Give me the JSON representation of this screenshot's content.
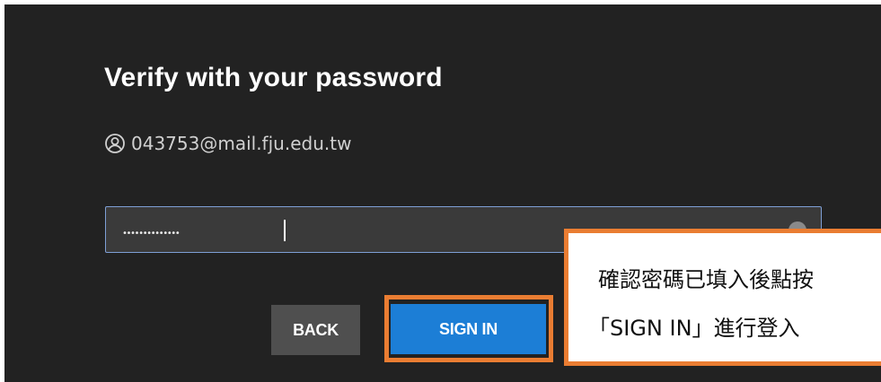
{
  "dialog": {
    "title": "Verify with your password",
    "identity_email": "043753@mail.fju.edu.tw",
    "identity_icon": "user-circle-icon",
    "password": {
      "masked_value": "••••••••••••••",
      "eye_icon": "eye-icon"
    },
    "buttons": {
      "back_label": "BACK",
      "signin_label": "SIGN IN"
    }
  },
  "annotation": {
    "line1": "確認密碼已填入後點按",
    "line2": "「SIGN IN」進行登入",
    "highlight_color": "#ea7d32"
  },
  "colors": {
    "panel_bg": "#222222",
    "primary_button": "#1c7ed6",
    "secondary_button": "#4f4f4f",
    "input_border": "#7e9fd6"
  }
}
